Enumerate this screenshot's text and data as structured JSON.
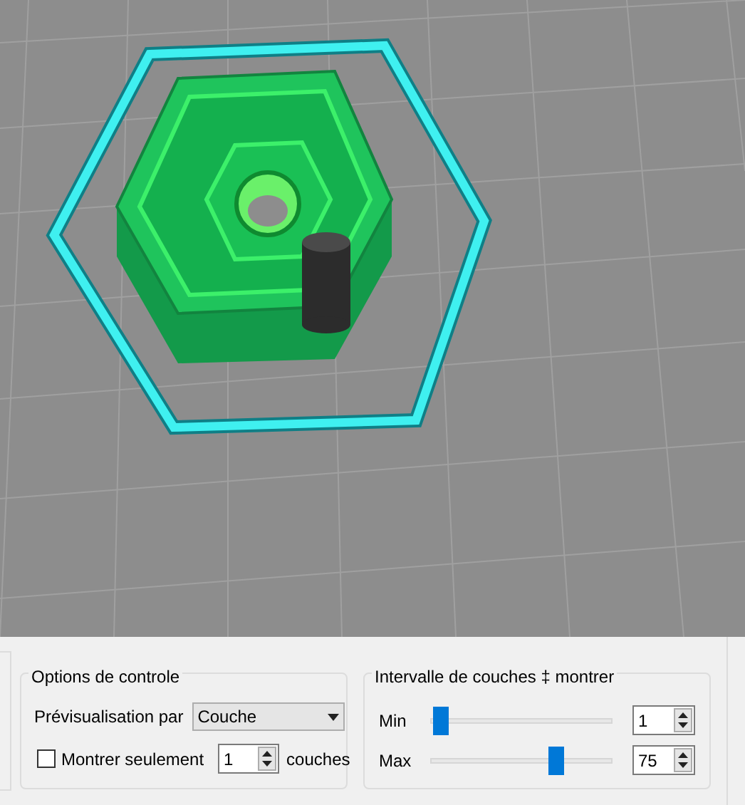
{
  "options_group": {
    "title": "Options de controle",
    "preview_label": "Prévisualisation par",
    "preview_mode": "Couche",
    "show_only": {
      "label": "Montrer seulement",
      "checked": false,
      "value": "1",
      "unit": "couches"
    }
  },
  "range_group": {
    "title": "Intervalle de couches ‡ montrer",
    "sliders": [
      {
        "label": "Min",
        "level": 0.02,
        "value": "1"
      },
      {
        "label": "Max",
        "level": 0.71,
        "value": "75"
      }
    ]
  }
}
